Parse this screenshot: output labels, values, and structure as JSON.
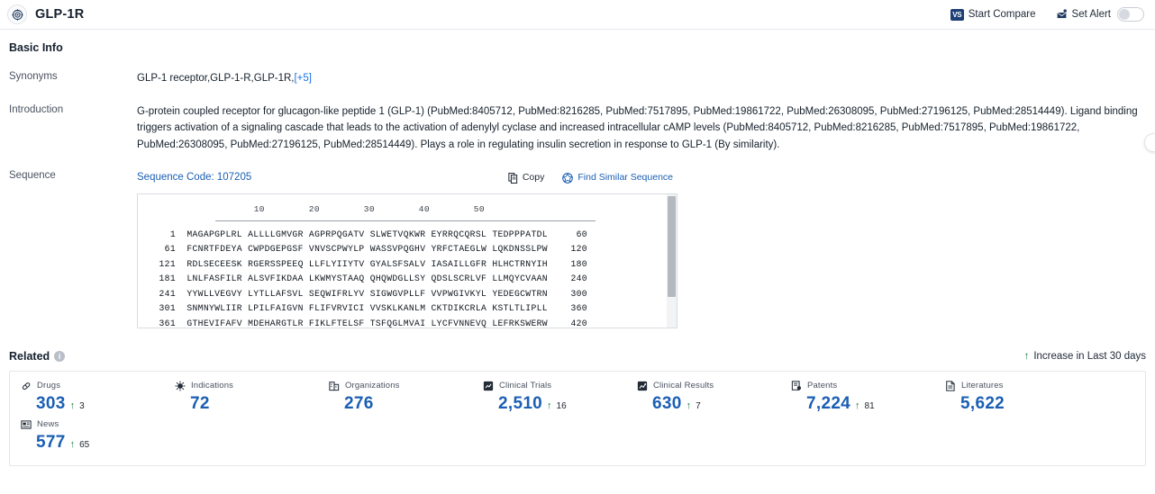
{
  "header": {
    "title": "GLP-1R",
    "target_icon": "target-icon",
    "actions": [
      {
        "label": "Start Compare",
        "icon": "vs-icon",
        "badge": "VS"
      },
      {
        "label": "Set Alert",
        "icon": "alert-bell-icon"
      }
    ],
    "alert_toggle_state": "off"
  },
  "basic_info": {
    "section_title": "Basic Info",
    "rows": [
      {
        "label": "Synonyms",
        "value": "GLP-1 receptor,GLP-1-R,GLP-1R,",
        "more": "[+5]"
      },
      {
        "label": "Introduction"
      },
      {
        "label": "Sequence"
      }
    ],
    "introduction": {
      "segments": [
        {
          "t": "G-protein coupled receptor for glucagon-like peptide 1 (GLP-1) (PubMed:"
        },
        {
          "t": "8405712",
          "link": true
        },
        {
          "t": ", PubMed:"
        },
        {
          "t": "8216285",
          "link": true
        },
        {
          "t": ", PubMed:"
        },
        {
          "t": "7517895",
          "link": true
        },
        {
          "t": ", PubMed:"
        },
        {
          "t": "19861722",
          "link": true
        },
        {
          "t": ", PubMed:"
        },
        {
          "t": "26308095",
          "link": true
        },
        {
          "t": ", PubMed:"
        },
        {
          "t": "27196125",
          "link": true
        },
        {
          "t": ", PubMed:"
        },
        {
          "t": "28514449",
          "link": true
        },
        {
          "t": "). Ligand binding triggers activation of a signaling cascade that leads to the activation of adenylyl cyclase and increased intracellular cAMP levels (PubMed:"
        },
        {
          "t": "8405712",
          "link": true
        },
        {
          "t": ", PubMed:"
        },
        {
          "t": "8216285",
          "link": true
        },
        {
          "t": ", PubMed:"
        },
        {
          "t": "7517895",
          "link": true
        },
        {
          "t": ", PubMed:"
        },
        {
          "t": "19861722",
          "link": true
        },
        {
          "t": ", PubMed:"
        },
        {
          "t": "26308095",
          "link": true
        },
        {
          "t": ", PubMed:"
        },
        {
          "t": "27196125",
          "link": true
        },
        {
          "t": ", PubMed:"
        },
        {
          "t": "28514449",
          "link": true
        },
        {
          "t": "). Plays a role in regulating insulin secretion in response to GLP-1 (By similarity)."
        }
      ]
    },
    "sequence": {
      "code_label": "Sequence Code: 107205",
      "tools": [
        {
          "label": "Copy",
          "icon": "copy-icon"
        },
        {
          "label": "Find Similar Sequence",
          "icon": "find-similar-icon"
        }
      ],
      "ruler_ticks": [
        "10",
        "20",
        "30",
        "40",
        "50"
      ],
      "rows": [
        {
          "start": "1",
          "seq": "MAGAPGPLRL ALLLLGMVGR AGPRPQGATV SLWETVQKWR EYRRQCQRSL TEDPPPATDL",
          "end": "60"
        },
        {
          "start": "61",
          "seq": "FCNRTFDEYA CWPDGEPGSF VNVSCPWYLP WASSVPQGHV YRFCTAEGLW LQKDNSSLPW",
          "end": "120"
        },
        {
          "start": "121",
          "seq": "RDLSECEESK RGERSSPEEQ LLFLYIIYTV GYALSFSALV IASAILLGFR HLHCTRNYIH",
          "end": "180"
        },
        {
          "start": "181",
          "seq": "LNLFASFILR ALSVFIKDAA LKWMYSTAAQ QHQWDGLLSY QDSLSCRLVF LLMQYCVAAN",
          "end": "240"
        },
        {
          "start": "241",
          "seq": "YYWLLVEGVY LYTLLAFSVL SEQWIFRLYV SIGWGVPLLF VVPWGIVKYL YEDEGCWTRN",
          "end": "300"
        },
        {
          "start": "301",
          "seq": "SNMNYWLIIR LPILFAIGVN FLIFVRVICI VVSKLKANLM CKTDIKCRLA KSTLTLIPLL",
          "end": "360"
        },
        {
          "start": "361",
          "seq": "GTHEVIFAFV MDEHARGTLR FIKLFTELSF TSFQGLMVAI LYCFVNNEVQ LEFRKSWERW",
          "end": "420"
        }
      ]
    }
  },
  "related": {
    "section_title": "Related",
    "info_glyph": "i",
    "legend_label": "Increase in Last 30 days",
    "legend_arrow": "↑",
    "stats": [
      {
        "label": "Drugs",
        "icon": "capsule-icon",
        "value": "303",
        "delta": "3"
      },
      {
        "label": "Indications",
        "icon": "virus-icon",
        "value": "72",
        "delta": ""
      },
      {
        "label": "Organizations",
        "icon": "building-icon",
        "value": "276",
        "delta": ""
      },
      {
        "label": "Clinical Trials",
        "icon": "clinical-trial-icon",
        "value": "2,510",
        "delta": "16"
      },
      {
        "label": "Clinical Results",
        "icon": "clinical-result-icon",
        "value": "630",
        "delta": "7"
      },
      {
        "label": "Patents",
        "icon": "patent-icon",
        "value": "7,224",
        "delta": "81"
      },
      {
        "label": "Literatures",
        "icon": "literature-icon",
        "value": "5,622",
        "delta": ""
      },
      {
        "label": "News",
        "icon": "news-icon",
        "value": "577",
        "delta": "65"
      }
    ]
  },
  "colors": {
    "link_blue": "#1a5fb4",
    "accent_blue": "#1a73e8",
    "increase_green": "#1a7f37",
    "text_dark": "#16202e"
  }
}
